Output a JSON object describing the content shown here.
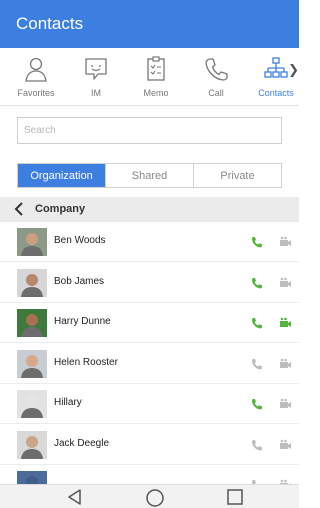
{
  "appbar": {
    "title": "Contacts"
  },
  "tabs": [
    {
      "label": "Favorites",
      "icon": "person-icon"
    },
    {
      "label": "IM",
      "icon": "chat-bubble-icon"
    },
    {
      "label": "Memo",
      "icon": "memo-icon"
    },
    {
      "label": "Call",
      "icon": "phone-icon"
    },
    {
      "label": "Contacts",
      "icon": "org-chart-icon",
      "active": true
    }
  ],
  "search": {
    "placeholder": "Search",
    "value": ""
  },
  "segments": {
    "items": [
      "Organization",
      "Shared",
      "Private"
    ],
    "selected": "Organization"
  },
  "breadcrumb": {
    "label": "Company"
  },
  "contacts": [
    {
      "name": "Ben Woods",
      "call_active": true,
      "chat_active": false
    },
    {
      "name": "Bob James",
      "call_active": true,
      "chat_active": false
    },
    {
      "name": "Harry Dunne",
      "call_active": true,
      "chat_active": true
    },
    {
      "name": "Helen Rooster",
      "call_active": false,
      "chat_active": false
    },
    {
      "name": "Hillary",
      "call_active": true,
      "chat_active": false
    },
    {
      "name": "Jack Deegle",
      "call_active": false,
      "chat_active": false
    },
    {
      "name": "",
      "call_active": false,
      "chat_active": false
    }
  ],
  "colors": {
    "accent": "#3d7fe0",
    "call_active": "#55b43e",
    "chat_active": "#55b43e",
    "icon_inactive": "#bdbdbd"
  },
  "nav": {
    "back_icon": "back-triangle-icon",
    "home_icon": "home-circle-icon",
    "recents_icon": "recents-square-icon"
  }
}
